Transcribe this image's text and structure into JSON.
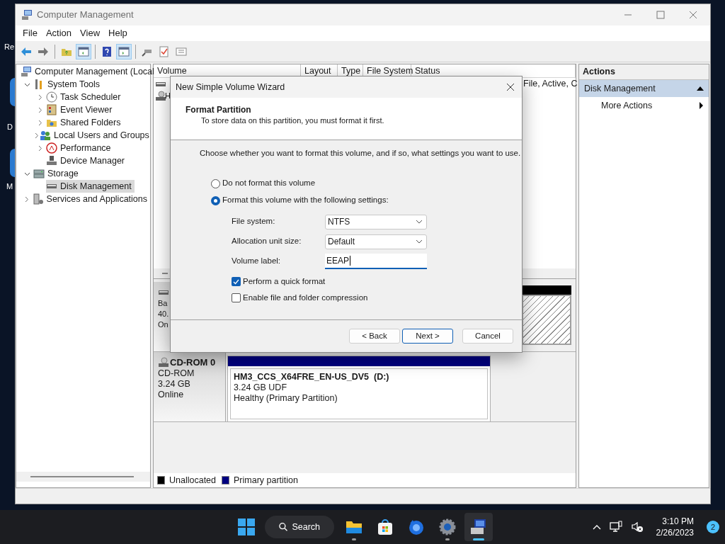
{
  "desktop_icons": [
    {
      "label": "Re"
    },
    {
      "label": "D"
    },
    {
      "label": "M"
    }
  ],
  "window": {
    "title": "Computer Management"
  },
  "menu": [
    "File",
    "Action",
    "View",
    "Help"
  ],
  "toolbar": [
    {
      "kind": "back",
      "pressed": false
    },
    {
      "kind": "forward",
      "pressed": false
    },
    {
      "kind": "separator"
    },
    {
      "kind": "up",
      "pressed": false
    },
    {
      "kind": "tree",
      "pressed": true
    },
    {
      "kind": "separator"
    },
    {
      "kind": "help",
      "pressed": false
    },
    {
      "kind": "pane",
      "pressed": true
    },
    {
      "kind": "separator"
    },
    {
      "kind": "connect",
      "pressed": false
    },
    {
      "kind": "check",
      "pressed": false
    },
    {
      "kind": "list",
      "pressed": false
    }
  ],
  "tree": [
    {
      "label": "Computer Management (Local",
      "kind": "computer",
      "selected": false,
      "children": [
        {
          "label": "System Tools",
          "kind": "tools",
          "expanded": true,
          "selected": false,
          "children": [
            {
              "label": "Task Scheduler",
              "kind": "clock",
              "expanded": false,
              "selected": false
            },
            {
              "label": "Event Viewer",
              "kind": "event",
              "expanded": false,
              "selected": false
            },
            {
              "label": "Shared Folders",
              "kind": "share",
              "expanded": false,
              "selected": false
            },
            {
              "label": "Local Users and Groups",
              "kind": "users",
              "expanded": false,
              "selected": false
            },
            {
              "label": "Performance",
              "kind": "perf",
              "expanded": false,
              "selected": false
            },
            {
              "label": "Device Manager",
              "kind": "device",
              "selected": false
            }
          ]
        },
        {
          "label": "Storage",
          "kind": "storage",
          "expanded": true,
          "selected": false,
          "children": [
            {
              "label": "Disk Management",
              "kind": "disk",
              "selected": true
            }
          ]
        },
        {
          "label": "Services and Applications",
          "kind": "services",
          "expanded": false,
          "selected": false
        }
      ]
    }
  ],
  "volume_table": {
    "columns": [
      "Volume",
      "Layout",
      "Type",
      "File System",
      "Status"
    ],
    "rows": [
      {
        "kind": "disk",
        "status": "File, Active, C"
      },
      {
        "kind": "cd",
        "volume": "H"
      }
    ]
  },
  "disks": [
    {
      "kind": "disk",
      "lines": [
        "Ba",
        "40.",
        "On"
      ],
      "partitions": [
        {
          "kind": "unallocated"
        }
      ]
    },
    {
      "kind": "cd",
      "title": "CD-ROM 0",
      "lines": [
        "CD-ROM",
        "3.24 GB",
        "Online"
      ],
      "partitions": [
        {
          "kind": "primary",
          "name": "HM3_CCS_X64FRE_EN-US_DV5  (D:)",
          "lines": [
            "3.24 GB UDF",
            "Healthy (Primary Partition)"
          ]
        }
      ]
    }
  ],
  "legend": [
    {
      "label": "Unallocated",
      "color": "#000000"
    },
    {
      "label": "Primary partition",
      "color": "#000080"
    }
  ],
  "actions": {
    "title": "Actions",
    "items": [
      {
        "kind": "header",
        "label": "Disk Management",
        "expanded": true
      },
      {
        "kind": "submenu",
        "label": "More Actions"
      }
    ]
  },
  "dialog": {
    "title": "New Simple Volume Wizard",
    "heading": "Format Partition",
    "subheading": "To store data on this partition, you must format it first.",
    "prompt": "Choose whether you want to format this volume, and if so, what settings you want to use.",
    "options": [
      {
        "label": "Do not format this volume",
        "selected": false
      },
      {
        "label": "Format this volume with the following settings:",
        "selected": true
      }
    ],
    "fields": [
      {
        "label": "File system:",
        "kind": "dropdown",
        "value": "NTFS"
      },
      {
        "label": "Allocation unit size:",
        "kind": "dropdown",
        "value": "Default"
      },
      {
        "label": "Volume label:",
        "kind": "text",
        "value": "EEAP"
      }
    ],
    "checkboxes": [
      {
        "label": "Perform a quick format",
        "checked": true
      },
      {
        "label": "Enable file and folder compression",
        "checked": false
      }
    ],
    "buttons": [
      {
        "label": "< Back",
        "default": false
      },
      {
        "label": "Next >",
        "default": true
      },
      {
        "label": "Cancel",
        "default": false
      }
    ]
  },
  "taskbar": {
    "search": "Search",
    "apps": [
      {
        "kind": "explorer",
        "running": true,
        "active": false
      },
      {
        "kind": "store",
        "running": false,
        "active": false
      },
      {
        "kind": "firefox",
        "running": false,
        "active": false
      },
      {
        "kind": "settings",
        "running": true,
        "active": false
      },
      {
        "kind": "compmgmt",
        "running": true,
        "active": true
      }
    ],
    "time": "3:10 PM",
    "date": "2/26/2023",
    "notifications": "2"
  }
}
